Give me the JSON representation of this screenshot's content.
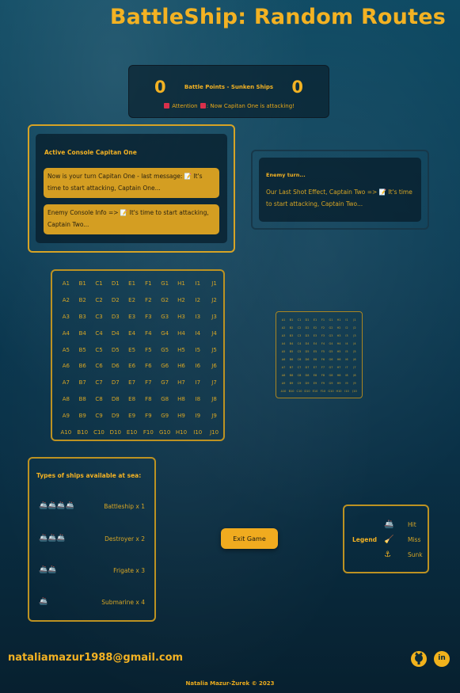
{
  "header": {
    "title": "BattleShip: Random Routes"
  },
  "scoreboard": {
    "player_score": "0",
    "enemy_score": "0",
    "label": "Battle Points - Sunken Ships",
    "attention_prefix": "Attention",
    "attention_suffix": ": Now Capitan One is attacking!"
  },
  "active_console": {
    "title": "Active Console Capitan One",
    "message1": "Now is your turn Capitan One - last message: 📝 It's time to start attacking, Captain One...",
    "message2": "Enemy Console Info => 📝 It's time to start attacking, Captain Two..."
  },
  "enemy_console": {
    "title": "Enemy turn...",
    "text": "Our Last Shot Effect, Captain Two => 📝 It's time to start attacking, Captain Two..."
  },
  "board": {
    "columns": [
      "A",
      "B",
      "C",
      "D",
      "E",
      "F",
      "G",
      "H",
      "I",
      "J"
    ],
    "rows": [
      "1",
      "2",
      "3",
      "4",
      "5",
      "6",
      "7",
      "8",
      "9",
      "10"
    ]
  },
  "ships": {
    "title": "Types of ships available at sea:",
    "items": [
      {
        "icons": "🚢🚢🚢🚢",
        "name": "Battleship x 1"
      },
      {
        "icons": "🚢🚢🚢",
        "name": "Destroyer x 2"
      },
      {
        "icons": "🚢🚢",
        "name": "Frigate x 3"
      },
      {
        "icons": "🚢",
        "name": "Submarine x 4"
      }
    ]
  },
  "exit_button": {
    "label": "Exit Game"
  },
  "legend": {
    "title": "Legend",
    "items": [
      {
        "icon": "ship-icon",
        "glyph": "🚢",
        "label": "Hit"
      },
      {
        "icon": "broom-icon",
        "glyph": "🧹",
        "label": "Miss"
      },
      {
        "icon": "anchor-icon",
        "glyph": "⚓",
        "label": "Sunk"
      }
    ]
  },
  "footer": {
    "email": "nataliamazur1988@gmail.com",
    "github_icon": "github-icon",
    "linkedin_icon": "linkedin-icon",
    "linkedin_glyph": "in",
    "copyright": "Natalia Mazur-Żurek © 2023"
  },
  "colors": {
    "accent": "#f3b223",
    "panel_border": "#d6a325",
    "background": "#0b3d56"
  }
}
